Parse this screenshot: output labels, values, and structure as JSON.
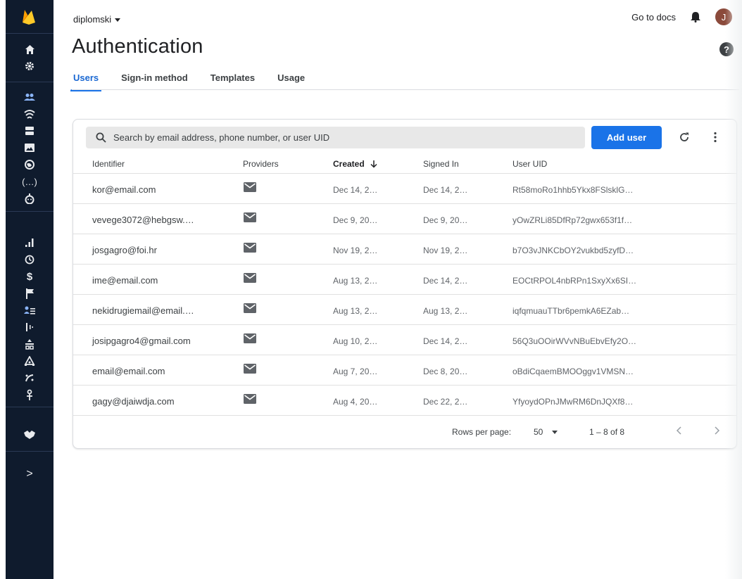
{
  "project": {
    "name": "diplomski"
  },
  "header": {
    "docs_label": "Go to docs",
    "avatar_initial": "J",
    "help_glyph": "?"
  },
  "page": {
    "title": "Authentication"
  },
  "tabs": [
    {
      "label": "Users",
      "active": true
    },
    {
      "label": "Sign-in method",
      "active": false
    },
    {
      "label": "Templates",
      "active": false
    },
    {
      "label": "Usage",
      "active": false
    }
  ],
  "toolbar": {
    "search_placeholder": "Search by email address, phone number, or user UID",
    "add_user_label": "Add user"
  },
  "table": {
    "columns": {
      "identifier": "Identifier",
      "providers": "Providers",
      "created": "Created",
      "signed_in": "Signed In",
      "uid": "User UID"
    },
    "sort_column": "Created",
    "sort_direction": "descending",
    "rows": [
      {
        "identifier": "kor@email.com",
        "provider": "email-icon",
        "created": "Dec 14, 2…",
        "signed_in": "Dec 14, 2…",
        "uid": "Rt58moRo1hhb5Ykx8FSlsklG…"
      },
      {
        "identifier": "vevege3072@hebgsw.…",
        "provider": "email-icon",
        "created": "Dec 9, 20…",
        "signed_in": "Dec 9, 20…",
        "uid": "yOwZRLi85DfRp72gwx653f1f…"
      },
      {
        "identifier": "josgagro@foi.hr",
        "provider": "email-icon",
        "created": "Nov 19, 2…",
        "signed_in": "Nov 19, 2…",
        "uid": "b7O3vJNKCbOY2vukbd5zyfD…"
      },
      {
        "identifier": "ime@email.com",
        "provider": "email-icon",
        "created": "Aug 13, 2…",
        "signed_in": "Dec 14, 2…",
        "uid": "EOCtRPOL4nbRPn1SxyXx6SI…"
      },
      {
        "identifier": "nekidrugiemail@email.…",
        "provider": "email-icon",
        "created": "Aug 13, 2…",
        "signed_in": "Aug 13, 2…",
        "uid": "iqfqmuauTTbr6pemkA6EZab…"
      },
      {
        "identifier": "josipgagro4@gmail.com",
        "provider": "email-icon",
        "created": "Aug 10, 2…",
        "signed_in": "Dec 14, 2…",
        "uid": "56Q3uOOirWVvNBuEbvEfy2O…"
      },
      {
        "identifier": "email@email.com",
        "provider": "email-icon",
        "created": "Aug 7, 20…",
        "signed_in": "Dec 8, 20…",
        "uid": "oBdiCqaemBMOOggv1VMSN…"
      },
      {
        "identifier": "gagy@djaiwdja.com",
        "provider": "email-icon",
        "created": "Aug 4, 20…",
        "signed_in": "Dec 22, 2…",
        "uid": "YfyoydOPnJMwRM6DnJQXf8…"
      }
    ]
  },
  "pagination": {
    "rows_per_page_label": "Rows per page:",
    "rows_per_page": "50",
    "range": "1 – 8 of 8"
  },
  "sidebar": {
    "items": [
      "home-icon",
      "settings-icon",
      "authentication-icon",
      "realtime-database-icon",
      "storage-icon",
      "hosting-icon",
      "functions-icon",
      "machine-learning-icon",
      "crashlytics-icon",
      "performance-icon",
      "test-lab-icon",
      "app-distribution-icon",
      "analytics-icon",
      "predictions-icon",
      "remote-config-icon",
      "cloud-messaging-icon",
      "in-app-messaging-icon",
      "dynamic-links-icon",
      "extensions-icon",
      "expand-icon"
    ]
  },
  "colors": {
    "accent": "#1a73e8",
    "sidebar_bg": "#0f1b2d",
    "active_sidebar": "#8ab4f8",
    "avatar": "#8b4a3b"
  }
}
